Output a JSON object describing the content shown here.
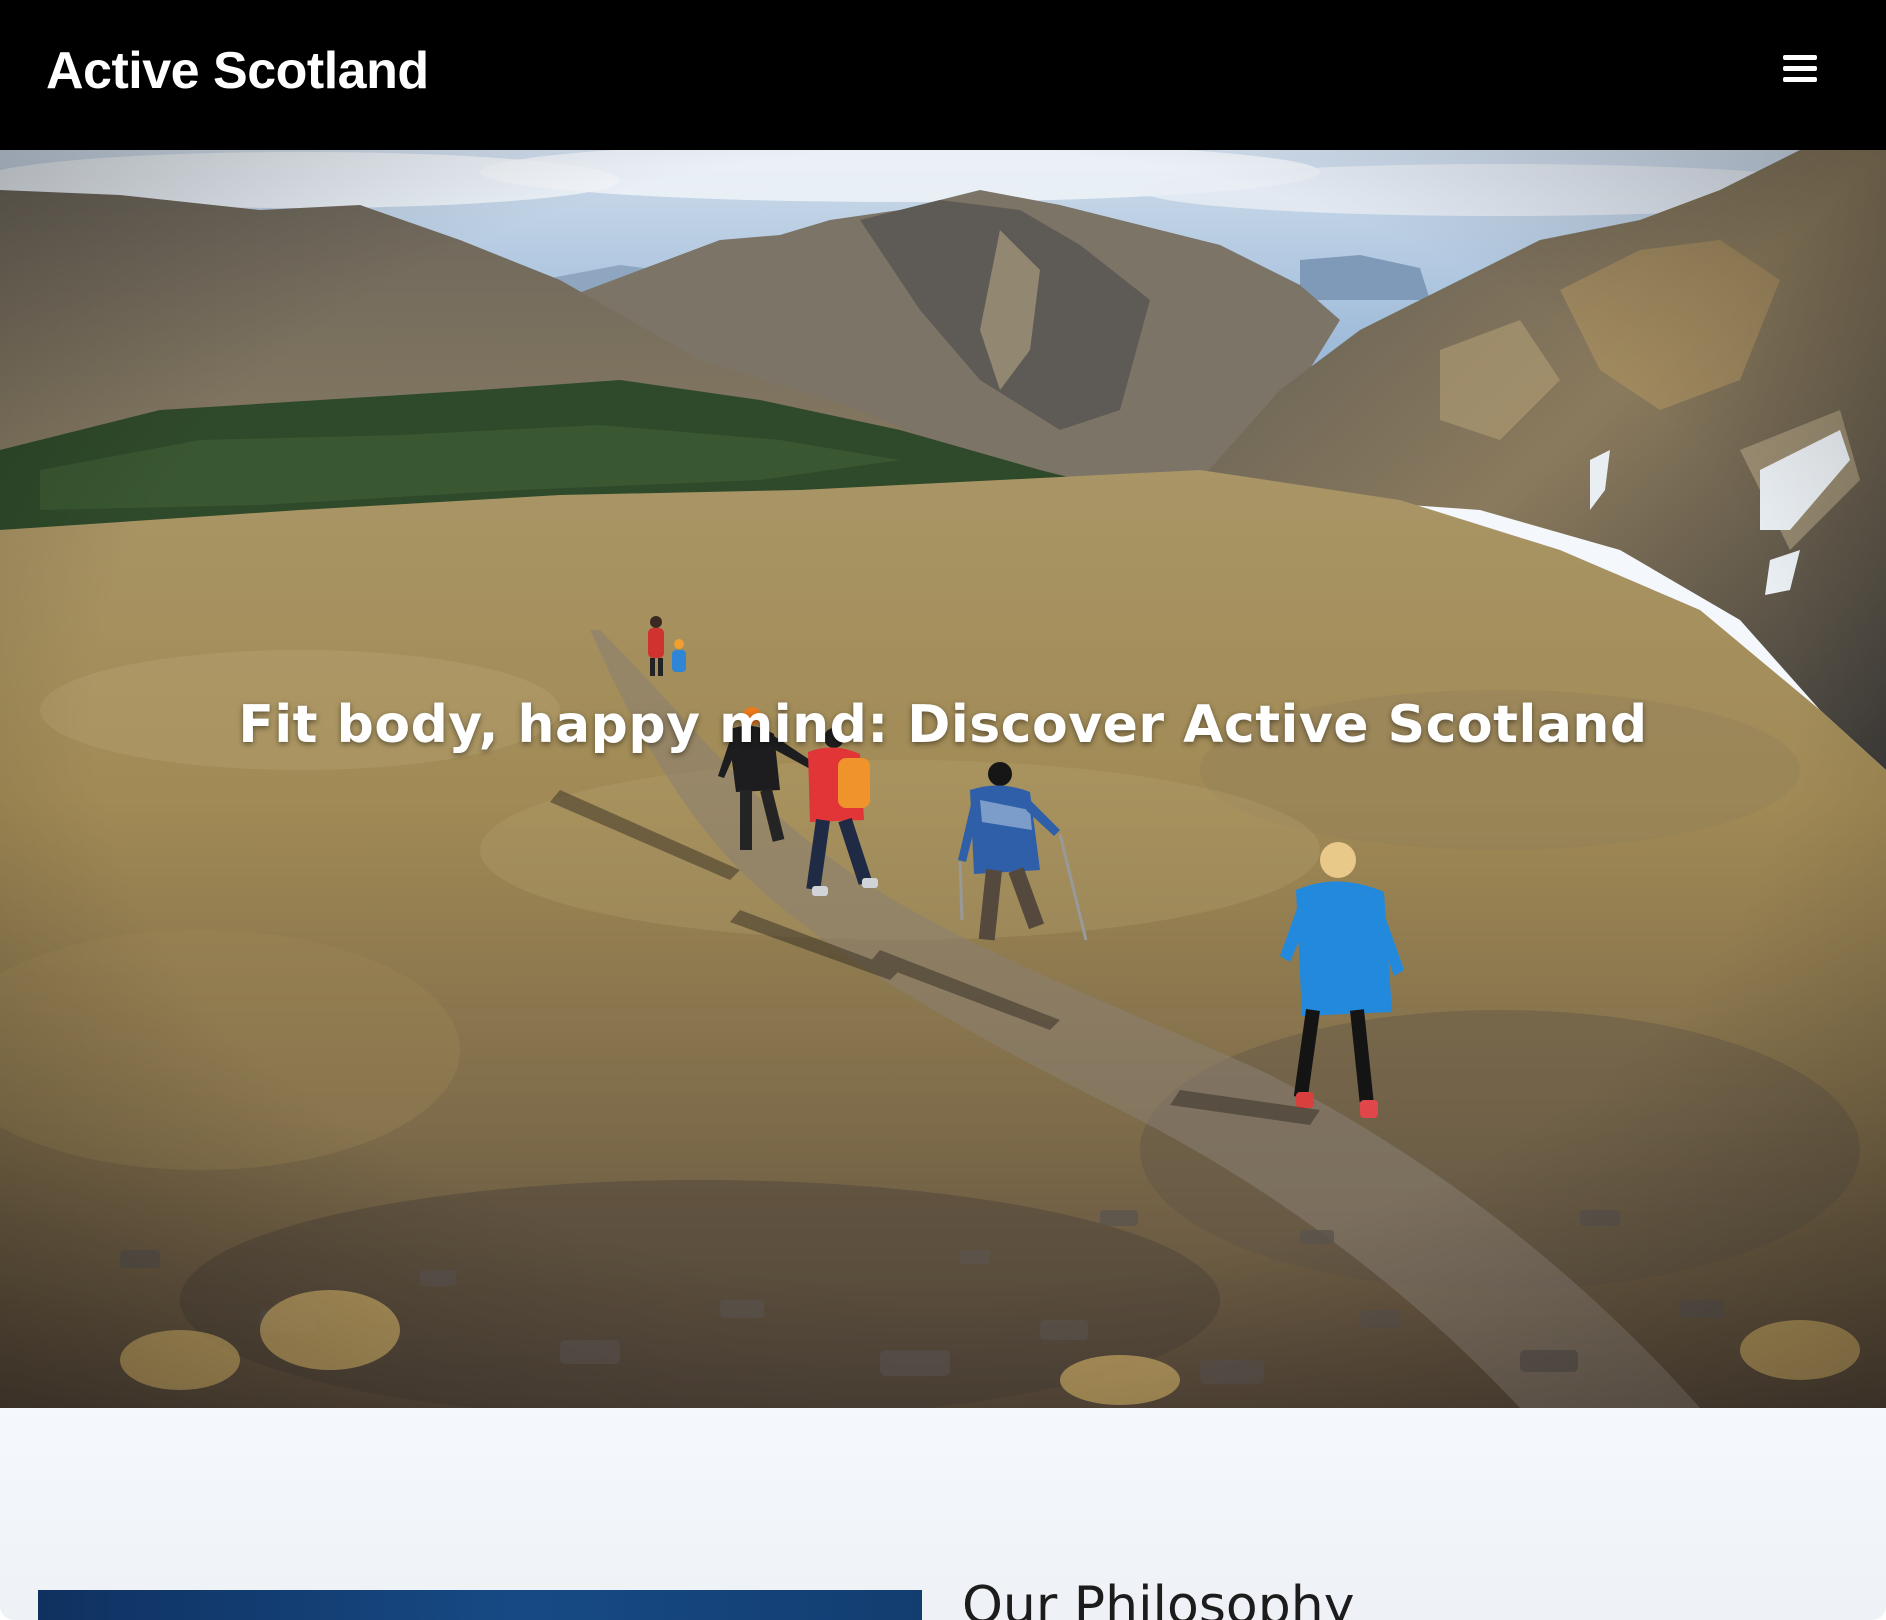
{
  "header": {
    "brand": "Active Scotland",
    "menu_icon": "hamburger-menu-icon"
  },
  "hero": {
    "title": "Fit body, happy mind: Discover Active Scotland",
    "image_description": "hikers-descending-mountain-trail-photo"
  },
  "philosophy": {
    "heading": "Our Philosophy"
  },
  "colors": {
    "header_bg": "#000000",
    "header_text": "#ffffff",
    "section_bg": "#f4f7fb",
    "heading_text": "#1c1c1c",
    "image_blue": "#174a85"
  }
}
